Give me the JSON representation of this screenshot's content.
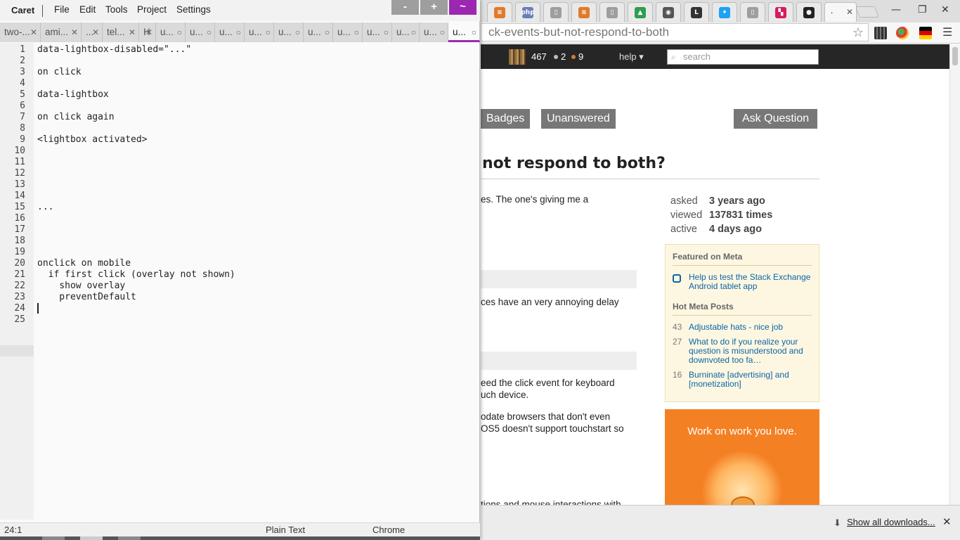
{
  "chrome": {
    "active_tab_label": ".",
    "tab_close_glyph": "✕",
    "window_controls": [
      "—",
      "❐",
      "✕"
    ],
    "url": "ck-events-but-not-respond-to-both",
    "star_glyph": "☆",
    "menu_glyph": "☰",
    "tab_favicons": [
      {
        "name": "stackexchange-favicon",
        "glyph": "≋",
        "color": "#e07a2b"
      },
      {
        "name": "php-favicon",
        "glyph": "php",
        "color": "#6c7eb7"
      },
      {
        "name": "page-favicon",
        "glyph": "▯",
        "color": "#9e9e9e"
      },
      {
        "name": "stackexchange-favicon",
        "glyph": "≋",
        "color": "#e07a2b"
      },
      {
        "name": "page-favicon",
        "glyph": "▯",
        "color": "#9e9e9e"
      },
      {
        "name": "google-drive-favicon",
        "glyph": "▲",
        "color": "#2d9d4e"
      },
      {
        "name": "reddit-favicon",
        "glyph": "◉",
        "color": "#555555"
      },
      {
        "name": "l-favicon",
        "glyph": "L",
        "color": "#333333"
      },
      {
        "name": "twitter-favicon",
        "glyph": "✦",
        "color": "#1da1f2"
      },
      {
        "name": "page-favicon",
        "glyph": "▯",
        "color": "#9e9e9e"
      },
      {
        "name": "bookmark-favicon",
        "glyph": "▚",
        "color": "#d81b60"
      },
      {
        "name": "github-favicon",
        "glyph": "●",
        "color": "#222222"
      }
    ]
  },
  "so": {
    "reputation": "467",
    "silver_badges": "2",
    "bronze_badges": "9",
    "help_label": "help ▾",
    "search_placeholder": "search",
    "nav": {
      "badges": "Badges",
      "unanswered": "Unanswered",
      "ask": "Ask Question"
    },
    "title": "not respond to both?",
    "body_lines": [
      "es. The one's giving me a",
      "ces have an very annoying delay",
      "eed the click event for keyboard",
      "uch device.",
      "odate browsers that don't even",
      "OS5 doesn't support touchstart so",
      "tions and mouse interactions with"
    ],
    "stats": [
      {
        "label": "asked",
        "value": "3 years ago"
      },
      {
        "label": "viewed",
        "value": "137831 times"
      },
      {
        "label": "active",
        "value": "4 days ago"
      }
    ],
    "featured_header": "Featured on Meta",
    "featured_item": "Help us test the Stack Exchange Android tablet app",
    "hot_header": "Hot Meta Posts",
    "hot_posts": [
      {
        "count": "43",
        "title": "Adjustable hats - nice job"
      },
      {
        "count": "27",
        "title": "What to do if you realize your question is misunderstood and downvoted too fa…"
      },
      {
        "count": "16",
        "title": "Burninate [advertising] and [monetization]"
      }
    ],
    "ad_text": "Work on work you love."
  },
  "downloads": {
    "show_all": "Show all downloads...",
    "icon": "⬇",
    "close": "✕"
  },
  "caret": {
    "app_name": "Caret",
    "menus": [
      "File",
      "Edit",
      "Tools",
      "Project",
      "Settings"
    ],
    "window_buttons": [
      "-",
      "+",
      "~"
    ],
    "tabs": [
      {
        "label": "two-...",
        "icon": "✕"
      },
      {
        "label": "ami...",
        "icon": "✕"
      },
      {
        "label": "...",
        "icon": "✕"
      },
      {
        "label": "tel...",
        "icon": "✕"
      },
      {
        "label": "H",
        "icon": "✕"
      },
      {
        "label": "u...",
        "icon": "○"
      },
      {
        "label": "u...",
        "icon": "○"
      },
      {
        "label": "u...",
        "icon": "○"
      },
      {
        "label": "u...",
        "icon": "○"
      },
      {
        "label": "u...",
        "icon": "○"
      },
      {
        "label": "u...",
        "icon": "○"
      },
      {
        "label": "u...",
        "icon": "○"
      },
      {
        "label": "u...",
        "icon": "○"
      },
      {
        "label": "u...",
        "icon": "○"
      },
      {
        "label": "u...",
        "icon": "○"
      },
      {
        "label": "u...",
        "icon": "○"
      }
    ],
    "line_numbers": [
      "1",
      "2",
      "3",
      "4",
      "5",
      "6",
      "7",
      "8",
      "9",
      "10",
      "11",
      "12",
      "13",
      "14",
      "15",
      "16",
      "17",
      "18",
      "19",
      "20",
      "21",
      "22",
      "23",
      "24",
      "25"
    ],
    "lines": [
      "data-lightbox-disabled=\"...\"",
      "",
      "on click",
      "",
      "data-lightbox",
      "",
      "on click again",
      "",
      "<lightbox activated>",
      "",
      "",
      "",
      "",
      "",
      "...",
      "",
      "",
      "",
      "",
      "onclick on mobile",
      "  if first click (overlay not shown)",
      "    show overlay",
      "    preventDefault",
      "",
      ""
    ],
    "status": {
      "position": "24:1",
      "mode": "Plain Text",
      "theme": "Chrome"
    }
  },
  "colors": {
    "caret_accent": "#9c27b0",
    "caret_button": "#9e9e9e",
    "so_topbar": "#262626",
    "so_ad": "#f48024",
    "so_link": "#0c65a5"
  }
}
